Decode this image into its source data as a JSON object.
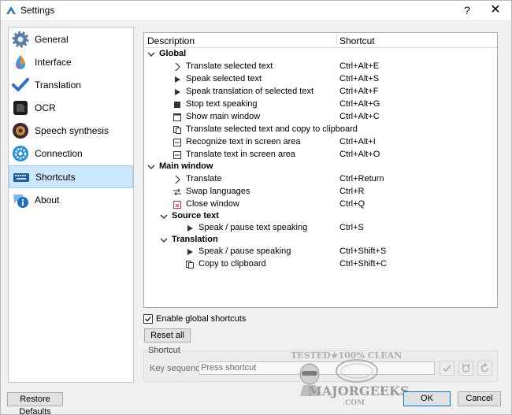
{
  "window": {
    "title": "Settings",
    "help_label": "?",
    "close_label": "✕"
  },
  "sidebar": {
    "items": [
      {
        "label": "General",
        "icon": "gear-icon"
      },
      {
        "label": "Interface",
        "icon": "palette-icon"
      },
      {
        "label": "Translation",
        "icon": "checkmark-icon"
      },
      {
        "label": "OCR",
        "icon": "ocr-icon"
      },
      {
        "label": "Speech synthesis",
        "icon": "speaker-icon"
      },
      {
        "label": "Connection",
        "icon": "connection-gear-icon"
      },
      {
        "label": "Shortcuts",
        "icon": "keyboard-icon"
      },
      {
        "label": "About",
        "icon": "info-icon"
      }
    ],
    "selected": "Shortcuts"
  },
  "tree": {
    "header": {
      "description": "Description",
      "shortcut": "Shortcut"
    },
    "rows": [
      {
        "label": "Global",
        "shortcut": "",
        "group": true
      },
      {
        "label": "Translate selected text",
        "shortcut": "Ctrl+Alt+E",
        "icon": "chevron-right-icon"
      },
      {
        "label": "Speak selected text",
        "shortcut": "Ctrl+Alt+S",
        "icon": "play-icon"
      },
      {
        "label": "Speak translation of selected text",
        "shortcut": "Ctrl+Alt+F",
        "icon": "play-icon"
      },
      {
        "label": "Stop text speaking",
        "shortcut": "Ctrl+Alt+G",
        "icon": "stop-icon"
      },
      {
        "label": "Show main window",
        "shortcut": "Ctrl+Alt+C",
        "icon": "window-icon"
      },
      {
        "label": "Translate selected text and copy to clipboard",
        "shortcut": "",
        "icon": "copy-icon"
      },
      {
        "label": "Recognize text in screen area",
        "shortcut": "Ctrl+Alt+I",
        "icon": "screen-area-icon"
      },
      {
        "label": "Translate text in screen area",
        "shortcut": "Ctrl+Alt+O",
        "icon": "screen-area-icon"
      },
      {
        "label": "Main window",
        "shortcut": "",
        "group": true
      },
      {
        "label": "Translate",
        "shortcut": "Ctrl+Return",
        "icon": "chevron-right-icon"
      },
      {
        "label": "Swap languages",
        "shortcut": "Ctrl+R",
        "icon": "swap-icon"
      },
      {
        "label": "Close window",
        "shortcut": "Ctrl+Q",
        "icon": "close-window-icon"
      },
      {
        "label": "Source text",
        "shortcut": "",
        "group": true
      },
      {
        "label": "Speak / pause text speaking",
        "shortcut": "Ctrl+S",
        "icon": "play-icon"
      },
      {
        "label": "Translation",
        "shortcut": "",
        "group": true
      },
      {
        "label": "Speak / pause speaking",
        "shortcut": "Ctrl+Shift+S",
        "icon": "play-icon"
      },
      {
        "label": "Copy to clipboard",
        "shortcut": "Ctrl+Shift+C",
        "icon": "copy-icon"
      }
    ]
  },
  "controls": {
    "enable_global_label": "Enable global shortcuts",
    "enable_global_checked": true,
    "reset_label": "Reset all",
    "shortcut_group_title": "Shortcut",
    "key_sequence_label": "Key sequence:",
    "key_sequence_placeholder": "Press shortcut",
    "restore_label": "Restore Defaults",
    "ok_label": "OK",
    "cancel_label": "Cancel"
  },
  "watermark": {
    "line1": "TESTED★100% CLEAN",
    "line2": "MAJORGEEKS",
    "line3": ".COM"
  },
  "colors": {
    "selection": "#cce8ff",
    "accent": "#0078d7"
  }
}
